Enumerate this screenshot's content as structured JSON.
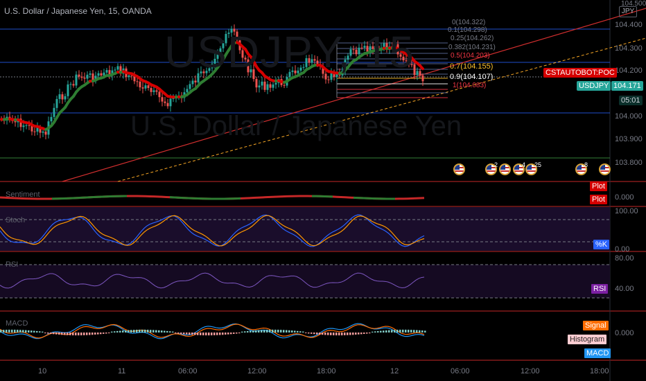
{
  "header": {
    "symbol_title": "U.S. Dollar / Japanese Yen, 15, OANDA",
    "currency_badge": "JPY",
    "watermark_symbol": "USDJPY, 15",
    "watermark_name": "U.S. Dollar / Japanese Yen"
  },
  "price_axis": {
    "ticks": [
      "104.500",
      "104.400",
      "104.300",
      "104.200",
      "104.000",
      "103.900",
      "103.800"
    ],
    "current_symbol": "USDJPY",
    "current_price": "104.171",
    "countdown": "05:01",
    "indicator_label": "CSTAUTOBOT:POC"
  },
  "time_axis": {
    "labels": [
      "10",
      "11",
      "06:00",
      "12:00",
      "18:00",
      "12",
      "06:00",
      "12:00",
      "18:00"
    ]
  },
  "fibonacci": {
    "levels": [
      {
        "text": "0(104.322)",
        "color": "#787b86"
      },
      {
        "text": "0.1(104.298)",
        "color": "#787b86"
      },
      {
        "text": "0.25(104.262)",
        "color": "#787b86"
      },
      {
        "text": "0.382(104.231)",
        "color": "#787b86"
      },
      {
        "text": "0.5(104.203)",
        "color": "#f23645"
      },
      {
        "text": "0.7(104.155)",
        "color": "#fbc02d"
      },
      {
        "text": "0.9(104.107)",
        "color": "#ffffff"
      },
      {
        "text": "1(104.083)",
        "color": "#f23645"
      }
    ]
  },
  "events": [
    {
      "name": "us-flag-event-1",
      "badge": ""
    },
    {
      "name": "us-flag-event-2",
      "badge": "2"
    },
    {
      "name": "us-flag-event-3",
      "badge": ""
    },
    {
      "name": "us-flag-event-4",
      "badge": "4"
    },
    {
      "name": "us-flag-event-5",
      "badge": "25"
    },
    {
      "name": "us-flag-event-6",
      "badge": "8"
    },
    {
      "name": "us-flag-event-7",
      "badge": ""
    }
  ],
  "panes": {
    "sentiment": {
      "label": "Sentiment",
      "tag1": "Plot",
      "tag2": "Plot",
      "value": "0.000"
    },
    "stoch": {
      "label": "Stoch",
      "tag": "%K",
      "ticks": [
        "100.00",
        "0.00"
      ]
    },
    "rsi": {
      "label": "RSI",
      "tag": "RSI",
      "ticks": [
        "80.00",
        "40.00"
      ]
    },
    "macd": {
      "label": "MACD",
      "signal": "Signal",
      "histogram": "Histogram",
      "macd": "MACD",
      "value": "0.000"
    }
  },
  "colors": {
    "bull": "#26a69a",
    "bear": "#ef5350",
    "ema_up": "#2e7d32",
    "ema_down": "#d50000",
    "trendline": "#d32f2f",
    "channel": "#f9a825",
    "stoch_k": "#2962ff",
    "stoch_d": "#ff9800",
    "rsi": "#7e57c2",
    "macd": "#2196f3",
    "signal": "#ff6d00"
  }
}
